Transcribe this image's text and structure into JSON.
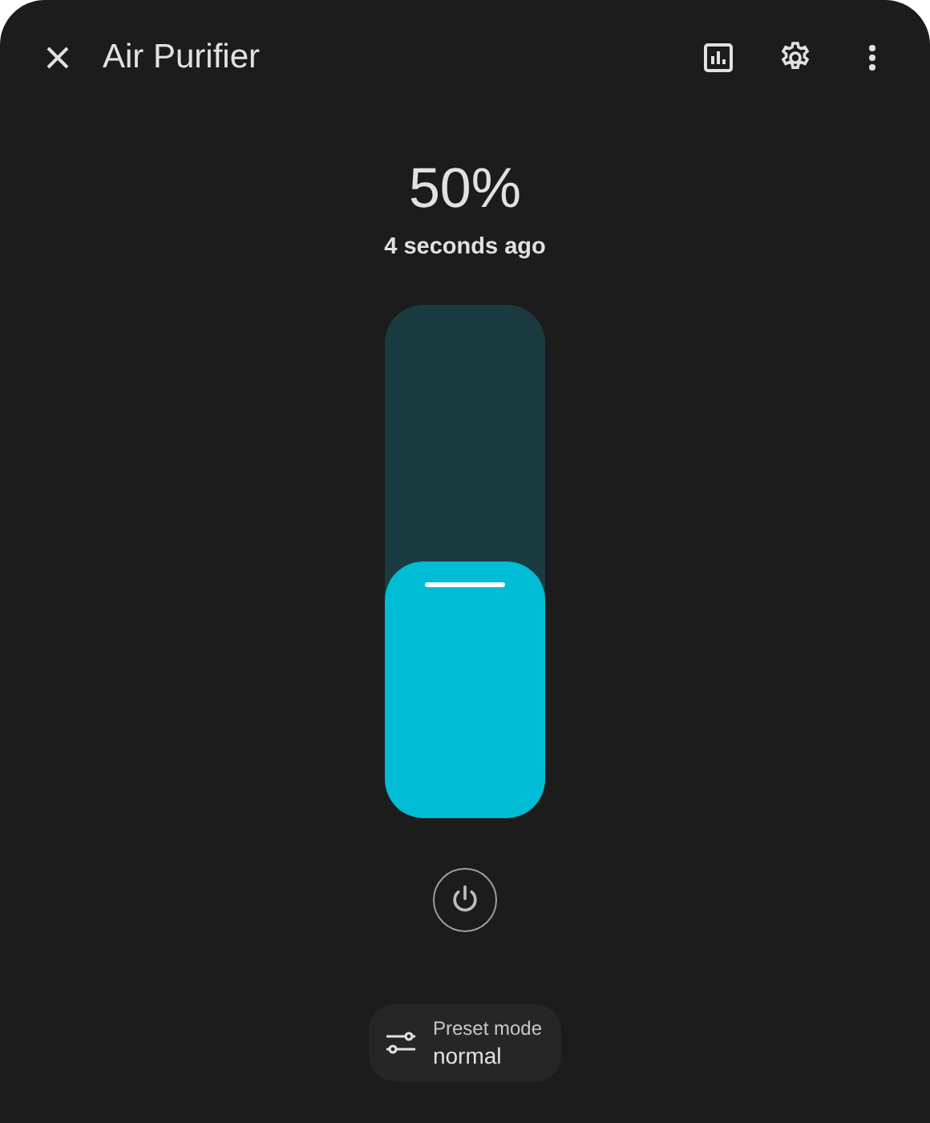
{
  "dialog": {
    "title": "Air Purifier"
  },
  "state": {
    "percentage": "50%",
    "last_changed": "4 seconds ago"
  },
  "preset": {
    "label": "Preset mode",
    "value": "normal"
  }
}
